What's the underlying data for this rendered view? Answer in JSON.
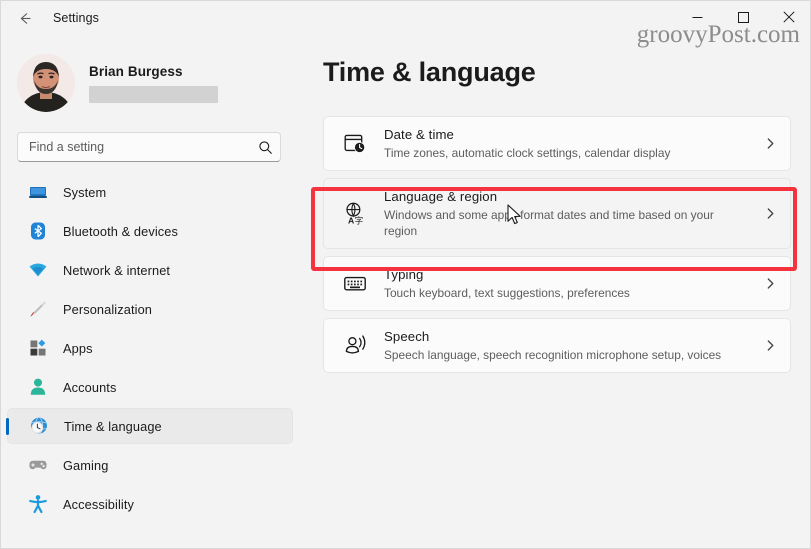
{
  "window": {
    "title": "Settings",
    "back_icon": "back-arrow-icon",
    "minimize_label": "─",
    "maximize_label": "□",
    "close_label": "✕"
  },
  "watermark": {
    "text": "groovyPost.com"
  },
  "sidebar": {
    "profile": {
      "name": "Brian Burgess",
      "email_redacted": true
    },
    "search": {
      "placeholder": "Find a setting",
      "value": "",
      "icon": "search-icon"
    },
    "items": [
      {
        "label": "System",
        "icon": "system-icon",
        "selected": false
      },
      {
        "label": "Bluetooth & devices",
        "icon": "bluetooth-icon",
        "selected": false
      },
      {
        "label": "Network & internet",
        "icon": "wifi-icon",
        "selected": false
      },
      {
        "label": "Personalization",
        "icon": "paintbrush-icon",
        "selected": false
      },
      {
        "label": "Apps",
        "icon": "apps-icon",
        "selected": false
      },
      {
        "label": "Accounts",
        "icon": "person-icon",
        "selected": false
      },
      {
        "label": "Time & language",
        "icon": "globe-clock-icon",
        "selected": true
      },
      {
        "label": "Gaming",
        "icon": "gamepad-icon",
        "selected": false
      },
      {
        "label": "Accessibility",
        "icon": "accessibility-icon",
        "selected": false
      }
    ]
  },
  "main": {
    "page_title": "Time & language",
    "cards": [
      {
        "title": "Date & time",
        "desc": "Time zones, automatic clock settings, calendar display",
        "icon": "calendar-clock-icon",
        "chevron": "chevron-right-icon",
        "highlighted": false
      },
      {
        "title": "Language & region",
        "desc": "Windows and some apps format dates and time based on your region",
        "icon": "globe-language-icon",
        "chevron": "chevron-right-icon",
        "highlighted": true
      },
      {
        "title": "Typing",
        "desc": "Touch keyboard, text suggestions, preferences",
        "icon": "keyboard-icon",
        "chevron": "chevron-right-icon",
        "highlighted": false
      },
      {
        "title": "Speech",
        "desc": "Speech language, speech recognition microphone setup, voices",
        "icon": "speech-icon",
        "chevron": "chevron-right-icon",
        "highlighted": false
      }
    ]
  },
  "annotation": {
    "highlight_color": "#f5333f",
    "highlight_target": "Language & region"
  },
  "colors": {
    "accent": "#0067c0",
    "background": "#f3f3f3",
    "card_background": "#fbfbfb",
    "text_primary": "#1b1b1b",
    "text_secondary": "#5d5d5d"
  }
}
